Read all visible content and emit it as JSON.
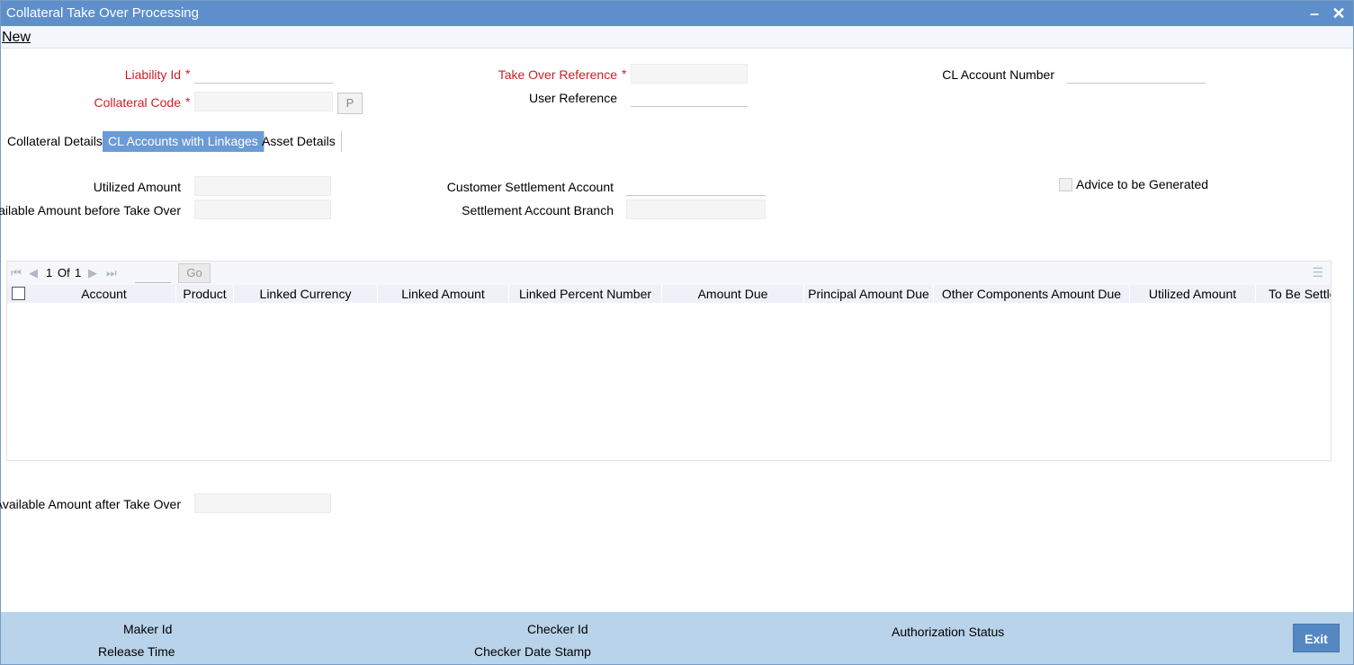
{
  "window": {
    "title": "Collateral Take Over Processing",
    "minimize_icon": "minimize-icon",
    "close_icon": "close-icon"
  },
  "menu": {
    "new_label": "New"
  },
  "header_fields": {
    "liability_id": {
      "label": "Liability Id",
      "value": ""
    },
    "collateral_code": {
      "label": "Collateral Code",
      "value": "",
      "pick_label": "P"
    },
    "take_over_reference": {
      "label": "Take Over Reference",
      "value": ""
    },
    "user_reference": {
      "label": "User Reference",
      "value": ""
    },
    "cl_account_number": {
      "label": "CL Account Number",
      "value": ""
    },
    "required_marker": "*"
  },
  "tabs": [
    {
      "label": "Collateral Details",
      "active": false
    },
    {
      "label": "CL Accounts with Linkages",
      "active": true
    },
    {
      "label": "Asset Details",
      "active": false
    }
  ],
  "details": {
    "utilized_amount": {
      "label": "Utilized Amount",
      "value": ""
    },
    "available_before": {
      "label": "Available Amount before Take Over",
      "value": ""
    },
    "customer_settlement_account": {
      "label": "Customer Settlement Account",
      "value": ""
    },
    "settlement_account_branch": {
      "label": "Settlement Account Branch",
      "value": ""
    },
    "advice_to_be_generated": {
      "label": "Advice to be Generated",
      "checked": false
    },
    "available_after": {
      "label": "Available Amount after Take Over",
      "value": ""
    }
  },
  "grid": {
    "pager": {
      "current": "1",
      "of_label": "Of",
      "total": "1",
      "go_label": "Go",
      "page_input": ""
    },
    "columns": [
      "Account",
      "Product",
      "Linked Currency",
      "Linked Amount",
      "Linked Percent Number",
      "Amount Due",
      "Principal Amount Due",
      "Other Components Amount Due",
      "Utilized Amount",
      "To Be Settled"
    ],
    "rows": []
  },
  "footer": {
    "maker_id": "Maker Id",
    "release_time": "Release Time",
    "checker_id": "Checker Id",
    "checker_date_stamp": "Checker Date Stamp",
    "authorization_status": "Authorization Status",
    "exit_label": "Exit"
  }
}
